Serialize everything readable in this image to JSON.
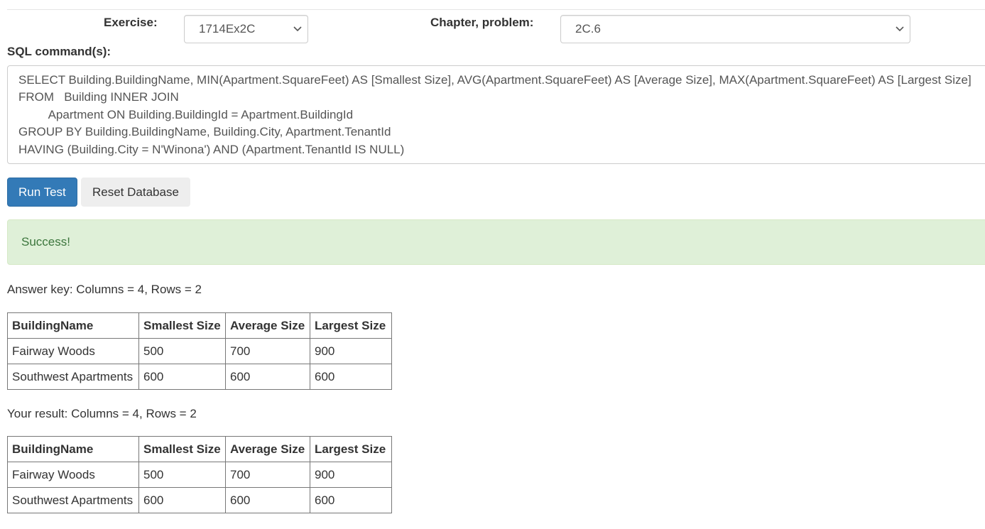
{
  "exercise": {
    "label": "Exercise:",
    "value": "1714Ex2C"
  },
  "chapter": {
    "label": "Chapter, problem:",
    "value": "2C.6"
  },
  "sql": {
    "label": "SQL command(s):",
    "text": "SELECT Building.BuildingName, MIN(Apartment.SquareFeet) AS [Smallest Size], AVG(Apartment.SquareFeet) AS [Average Size], MAX(Apartment.SquareFeet) AS [Largest Size]\nFROM   Building INNER JOIN\n         Apartment ON Building.BuildingId = Apartment.BuildingId\nGROUP BY Building.BuildingName, Building.City, Apartment.TenantId\nHAVING (Building.City = N'Winona') AND (Apartment.TenantId IS NULL)"
  },
  "buttons": {
    "run": "Run Test",
    "reset": "Reset Database"
  },
  "alert": {
    "text": "Success!"
  },
  "answer_key": {
    "summary": "Answer key: Columns = 4, Rows = 2",
    "headers": [
      "BuildingName",
      "Smallest Size",
      "Average Size",
      "Largest Size"
    ],
    "rows": [
      [
        "Fairway Woods",
        "500",
        "700",
        "900"
      ],
      [
        "Southwest Apartments",
        "600",
        "600",
        "600"
      ]
    ]
  },
  "your_result": {
    "summary": "Your result: Columns = 4, Rows = 2",
    "headers": [
      "BuildingName",
      "Smallest Size",
      "Average Size",
      "Largest Size"
    ],
    "rows": [
      [
        "Fairway Woods",
        "500",
        "700",
        "900"
      ],
      [
        "Southwest Apartments",
        "600",
        "600",
        "600"
      ]
    ]
  },
  "colors": {
    "primary": "#337ab7",
    "success_bg": "#dff0d8",
    "success_text": "#3c763d"
  },
  "icons": {
    "select_arrow": "chevron-down-icon"
  }
}
